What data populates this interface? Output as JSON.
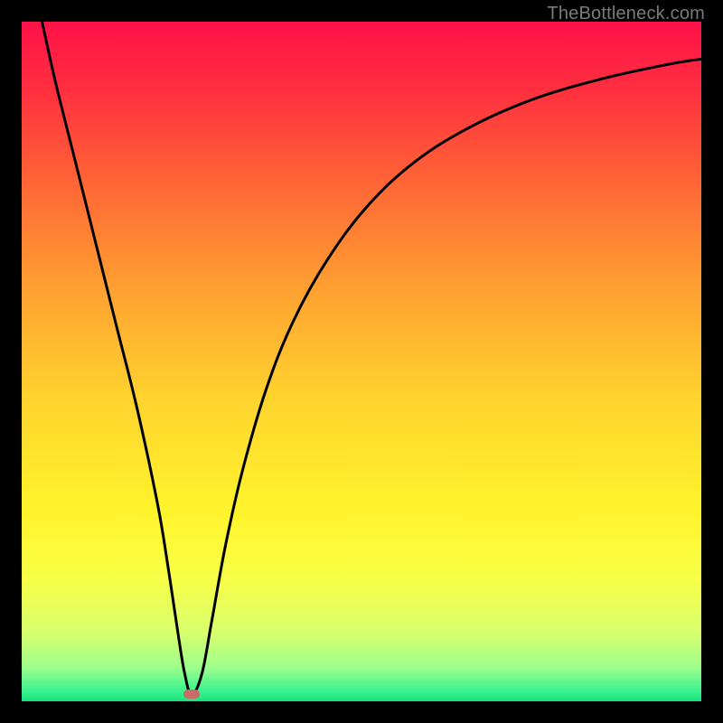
{
  "watermark": "TheBottleneck.com",
  "colors": {
    "border": "#000000",
    "curve": "#000000",
    "marker": "#cb6a69",
    "gradient_stops": [
      {
        "stop": 0.0,
        "color": "#ff1249"
      },
      {
        "stop": 0.1,
        "color": "#ff2f3f"
      },
      {
        "stop": 0.25,
        "color": "#ff6a35"
      },
      {
        "stop": 0.4,
        "color": "#ffa331"
      },
      {
        "stop": 0.55,
        "color": "#ffd22e"
      },
      {
        "stop": 0.72,
        "color": "#fff42c"
      },
      {
        "stop": 0.82,
        "color": "#f8ff47"
      },
      {
        "stop": 0.9,
        "color": "#d7ff6e"
      },
      {
        "stop": 0.95,
        "color": "#9dff8c"
      },
      {
        "stop": 0.985,
        "color": "#3bf28f"
      },
      {
        "stop": 1.0,
        "color": "#17e37d"
      }
    ]
  },
  "chart_data": {
    "type": "line",
    "title": "",
    "xlabel": "",
    "ylabel": "",
    "xlim": [
      0,
      100
    ],
    "ylim": [
      0,
      100
    ],
    "series": [
      {
        "name": "bottleneck-curve",
        "x": [
          3,
          5,
          8,
          11,
          14,
          17,
          20,
          21.5,
          23,
          24,
          25,
          26.5,
          28,
          30,
          32.5,
          36,
          40,
          45,
          51,
          58,
          66,
          75,
          85,
          95,
          100
        ],
        "y": [
          100,
          91,
          79,
          67,
          55,
          43,
          29,
          20,
          10,
          4,
          1,
          4,
          12,
          23,
          34,
          46,
          56,
          65,
          73,
          79.5,
          84.5,
          88.5,
          91.5,
          93.7,
          94.5
        ]
      }
    ],
    "marker": {
      "x": 25,
      "y": 1,
      "color": "#cb6a69"
    },
    "annotations": []
  }
}
